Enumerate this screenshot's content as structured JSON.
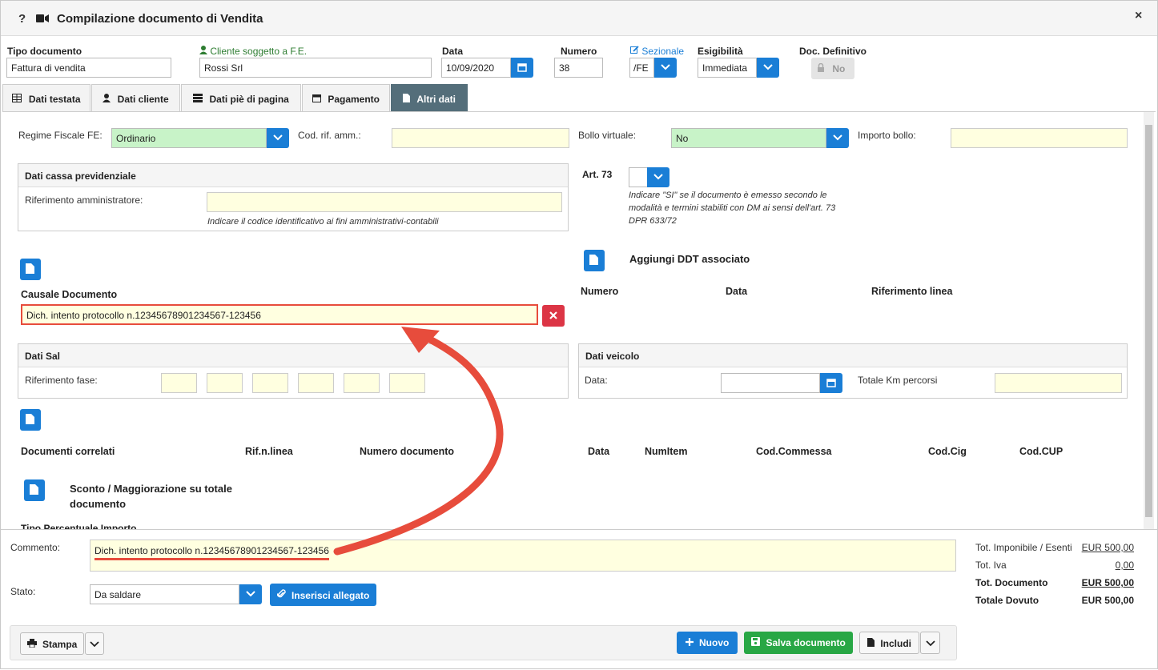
{
  "window": {
    "title": "Compilazione documento di Vendita",
    "help_label": "?",
    "close_label": "×"
  },
  "header": {
    "tipo_documento": {
      "label": "Tipo documento",
      "value": "Fattura di vendita"
    },
    "cliente": {
      "label": "Cliente soggetto a F.E.",
      "value": "Rossi Srl"
    },
    "data": {
      "label": "Data",
      "value": "10/09/2020"
    },
    "numero": {
      "label": "Numero",
      "value": "38"
    },
    "sezionale": {
      "label": "Sezionale",
      "value": "/FE"
    },
    "esigibilita": {
      "label": "Esigibilità",
      "value": "Immediata"
    },
    "doc_definitivo": {
      "label": "Doc. Definitivo",
      "value": "No"
    }
  },
  "tabs": [
    {
      "label": "Dati testata",
      "icon": "table-icon"
    },
    {
      "label": "Dati cliente",
      "icon": "user-icon"
    },
    {
      "label": "Dati piè di pagina",
      "icon": "server-icon"
    },
    {
      "label": "Pagamento",
      "icon": "calendar-icon"
    },
    {
      "label": "Altri dati",
      "icon": "file-icon"
    }
  ],
  "altri_dati": {
    "regime_fiscale": {
      "label": "Regime Fiscale FE:",
      "value": "Ordinario"
    },
    "cod_rif_amm": {
      "label": "Cod. rif. amm.:",
      "value": ""
    },
    "bollo_virtuale": {
      "label": "Bollo virtuale:",
      "value": "No"
    },
    "importo_bollo": {
      "label": "Importo bollo:",
      "value": ""
    },
    "cassa": {
      "title": "Dati cassa previdenziale",
      "rif_label": "Riferimento amministratore:",
      "hint": "Indicare il codice identificativo ai fini amministrativi-contabili"
    },
    "art73": {
      "label": "Art. 73",
      "hint": "Indicare \"SI\" se il documento è emesso secondo le modalità e termini stabiliti con DM ai sensi dell'art. 73 DPR 633/72"
    },
    "ddt": {
      "title": "Aggiungi DDT associato",
      "cols": [
        "Numero",
        "Data",
        "Riferimento linea"
      ]
    },
    "causale": {
      "label": "Causale Documento",
      "value": "Dich. intento protocollo n.12345678901234567-123456"
    },
    "sal": {
      "title": "Dati Sal",
      "rif_label": "Riferimento fase:"
    },
    "veicolo": {
      "title": "Dati veicolo",
      "data_label": "Data:",
      "km_label": "Totale Km percorsi"
    },
    "correlati": {
      "cols": [
        "Documenti correlati",
        "Rif.n.linea",
        "Numero documento",
        "Data",
        "NumItem",
        "Cod.Commessa",
        "Cod.Cig",
        "Cod.CUP"
      ]
    },
    "sconto": {
      "title": "Sconto / Maggiorazione su totale documento",
      "cut_text": "Tipo Percentuale Importo"
    }
  },
  "footer": {
    "commento": {
      "label": "Commento:",
      "value": "Dich. intento protocollo n.12345678901234567-123456"
    },
    "stato": {
      "label": "Stato:",
      "value": "Da saldare"
    },
    "allegato_label": "Inserisci allegato",
    "totals": [
      {
        "label": "Tot. Imponibile / Esenti",
        "value": "EUR 500,00",
        "bold": false
      },
      {
        "label": "Tot. Iva",
        "value": "0,00",
        "bold": false
      },
      {
        "label": "Tot. Documento",
        "value": "EUR 500,00",
        "bold": true
      },
      {
        "label": "Totale Dovuto",
        "value": "EUR 500,00",
        "bold": true
      }
    ],
    "buttons": {
      "stampa": "Stampa",
      "nuovo": "Nuovo",
      "salva": "Salva documento",
      "includi": "Includi"
    }
  },
  "colors": {
    "accent": "#1a7ed6",
    "danger": "#dc3545",
    "success": "#28a745",
    "highlight": "#e74c3c",
    "tab_active": "#546e7a",
    "required_field": "#ffffe0",
    "valid_field": "#c8f3c8"
  }
}
